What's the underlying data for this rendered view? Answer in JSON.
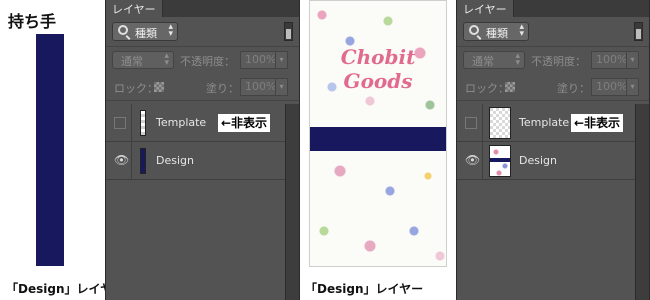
{
  "left": {
    "title": "持ち手",
    "caption": "「Design」レイヤー"
  },
  "middle": {
    "logo_line_1": "Chobit",
    "logo_line_2": "Goods",
    "caption": "「Design」レイヤー"
  },
  "panel": {
    "tab_label": "レイヤー",
    "filter_label": "種類",
    "blend_mode": "通常",
    "opacity_label": "不透明度：",
    "opacity_value": "100%",
    "lock_label": "ロック：",
    "fill_label": "塗り：",
    "fill_value": "100%"
  },
  "layers": [
    {
      "name": "Template",
      "annotation": "←非表示"
    },
    {
      "name": "Design"
    }
  ],
  "colors": {
    "navy": "#17185e",
    "panel": "#535353",
    "pink": "#e06b8f"
  },
  "icons": [
    "search-icon",
    "chevron-updown-icon",
    "checkerboard-icon",
    "eye-icon"
  ]
}
